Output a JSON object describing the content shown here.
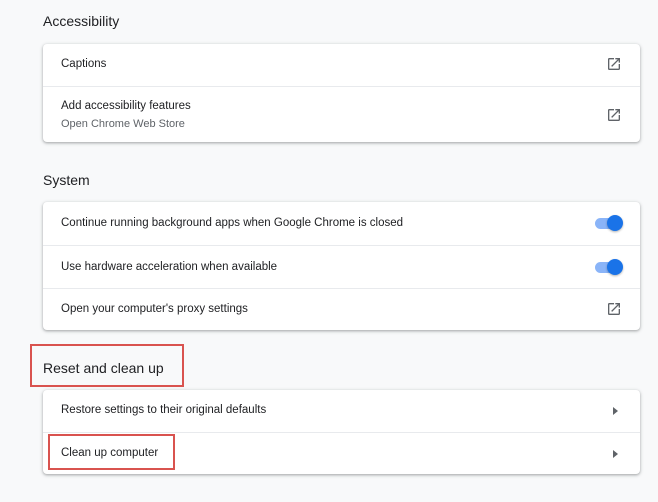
{
  "accessibility": {
    "title": "Accessibility",
    "captions_label": "Captions",
    "add_features_label": "Add accessibility features",
    "add_features_sub": "Open Chrome Web Store"
  },
  "system": {
    "title": "System",
    "background_apps_label": "Continue running background apps when Google Chrome is closed",
    "background_apps_enabled": true,
    "hardware_accel_label": "Use hardware acceleration when available",
    "hardware_accel_enabled": true,
    "proxy_label": "Open your computer's proxy settings"
  },
  "reset": {
    "title": "Reset and clean up",
    "restore_label": "Restore settings to their original defaults",
    "cleanup_label": "Clean up computer"
  },
  "colors": {
    "toggle_knob": "#1a73e8",
    "toggle_track": "#8ab4f8",
    "highlight_box": "#d9534f"
  },
  "icons": {
    "external_link": "open-in-new-icon",
    "subpage_arrow": "arrow-right-icon"
  }
}
